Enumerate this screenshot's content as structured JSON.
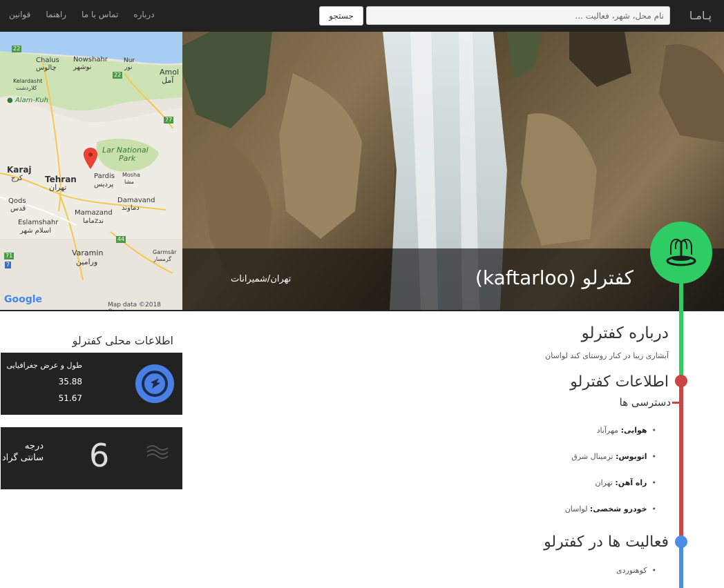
{
  "navbar": {
    "brand": "پـامـا",
    "search_placeholder": "نام محل، شهر، فعالیت ...",
    "search_button": "جستجو",
    "links": [
      "درباره",
      "تماس با ما",
      "راهنما",
      "قوانین"
    ]
  },
  "hero": {
    "title": "کفترلو (kaftarloo)",
    "location": "تهران/شمیرانات",
    "icon": "fountain-icon"
  },
  "map": {
    "labels": {
      "chalus": "Chalus",
      "chalus_fa": "چالوس",
      "nowshahr": "Nowshahr",
      "nowshahr_fa": "نوشهر",
      "nur": "Nur",
      "nur_fa": "نور",
      "amol": "Amol",
      "amol_fa": "آمل",
      "kelardasht": "Kelardasht",
      "kelardasht_fa": "کلاردشت",
      "alam_kuh": "Alam-Kuh",
      "lar_park": "Lar National",
      "lar_park2": "Park",
      "karaj": "Karaj",
      "karaj_fa": "کرج",
      "tehran": "Tehran",
      "tehran_fa": "تهران",
      "pardis": "Pardis",
      "pardis_fa": "پردیس",
      "mosha": "Mosha",
      "mosha_fa": "مشا",
      "qods": "Qods",
      "qods_fa": "قدس",
      "damavand": "Damavand",
      "damavand_fa": "دماوند",
      "mamazand": "Mamazand",
      "mamazand_fa": "ماماzند",
      "eslamshahr": "Eslamshahr",
      "eslamshahr_fa": "اسلام شهر",
      "varamin": "Varamin",
      "varamin_fa": "ورامین",
      "garmsar": "Garmsār",
      "garmsar_fa": "گرمسار",
      "r22": "22",
      "r22b": "22",
      "r77": "77",
      "r44": "44",
      "r71": "71",
      "r7": "7"
    },
    "google": "Google",
    "attribution": "Map data ©2018 Google"
  },
  "sidebar": {
    "local_info_title": "اطلاعات محلی کفترلو",
    "coords_label": "طول و عرض جغرافیایی",
    "lat": "35.88",
    "lng": "51.67",
    "temp_value": "6",
    "temp_unit1": "درجه",
    "temp_unit2": "سانتی گراد"
  },
  "content": {
    "about_title": "درباره کفترلو",
    "about_text": "آبشاری زیبا در کنار روستای کند لواسان",
    "info_title": "اطلاعات کفترلو",
    "access_title": "دسترسی ها",
    "access_items": [
      {
        "k": "هوایی:",
        "v": " مهرآباد"
      },
      {
        "k": "اتوبوس:",
        "v": " ترمینال شرق"
      },
      {
        "k": "راه آهن:",
        "v": " تهران"
      },
      {
        "k": "خودرو شخصی:",
        "v": " لواسان"
      }
    ],
    "activities_title": "فعالیت ها در کفترلو",
    "activities": [
      "کوهنوردی"
    ]
  },
  "colors": {
    "green": "#2ecc63",
    "red": "#cc4444",
    "blue": "#4a8ee8"
  }
}
